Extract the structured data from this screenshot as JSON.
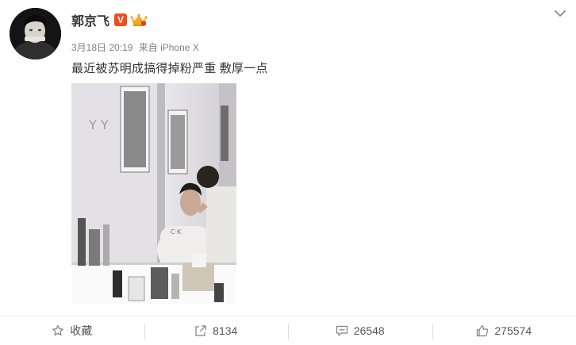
{
  "post": {
    "author": "郭京飞",
    "verified_badge": "V",
    "date": "3月18日 20:19",
    "source": "来自 iPhone X",
    "text": "最近被苏明成搞得掉粉严重 敷厚一点"
  },
  "actions": {
    "favorite": "收藏",
    "repost_count": "8134",
    "comment_count": "26548",
    "like_count": "275574"
  },
  "icons": {
    "more": "chevron-down-icon",
    "verified": "verified-icon",
    "member": "crown-icon",
    "favorite": "star-icon",
    "repost": "share-icon",
    "comment": "comment-icon",
    "like": "thumbs-up-icon"
  },
  "colors": {
    "verified": "#f24b1c",
    "crown": "#f5a623",
    "text": "#333333",
    "meta": "#808080"
  }
}
